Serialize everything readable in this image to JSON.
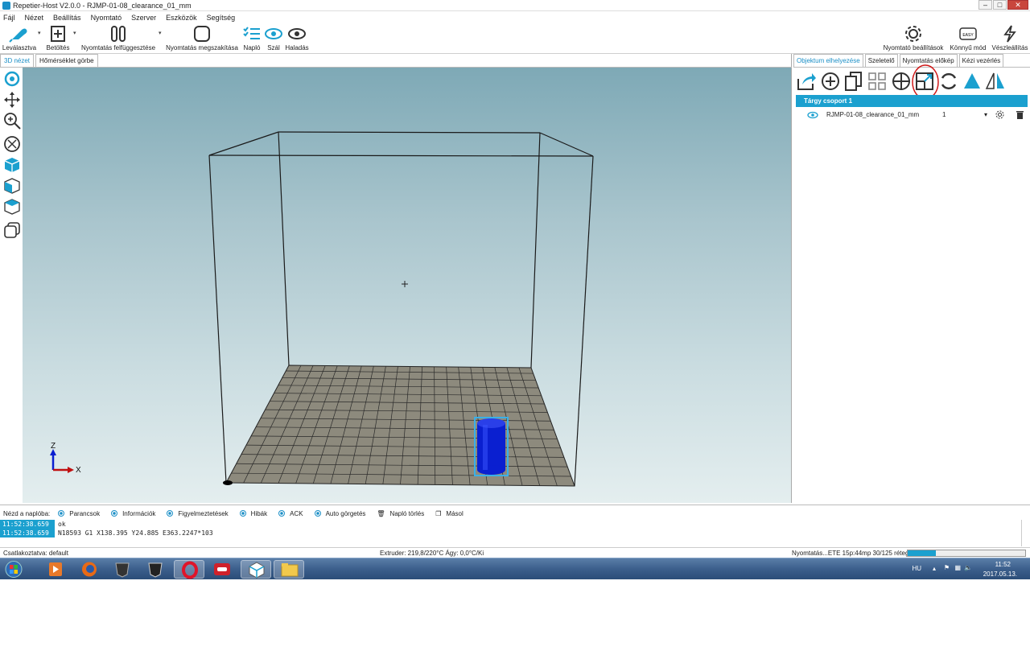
{
  "window": {
    "title": "Repetier-Host V2.0.0 - RJMP-01-08_clearance_01_mm",
    "min": "–",
    "max": "□",
    "close": "✕"
  },
  "menu": [
    "Fájl",
    "Nézet",
    "Beállítás",
    "Nyomtató",
    "Szerver",
    "Eszközök",
    "Segítség"
  ],
  "toolbar": {
    "disconnect": "Leválasztva",
    "load": "Betöltés",
    "pause": "Nyomtatás felfüggesztése",
    "stop": "Nyomtatás megszakítása",
    "log": "Napló",
    "filament": "Szál",
    "advanced": "Haladás",
    "printer_settings": "Nyomtató beállítások",
    "easy_mode": "Könnyű mód",
    "easy_badge": "EASY",
    "emergency": "Vészleállítás"
  },
  "view_tabs": [
    "3D nézet",
    "Hőmérséklet görbe"
  ],
  "right_tabs": [
    "Objektum elhelyezése",
    "Szeletelő",
    "Nyomtatás előkép",
    "Kézi vezérlés"
  ],
  "object_group": {
    "header": "Tárgy csoport 1",
    "objects": [
      {
        "name": "RJMP-01-08_clearance_01_mm",
        "count": "1"
      }
    ]
  },
  "axes": {
    "z": "Z",
    "x": "X"
  },
  "log": {
    "label": "Nézd a naplóba:",
    "filters": [
      "Parancsok",
      "Információk",
      "Figyelmeztetések",
      "Hibák",
      "ACK",
      "Auto görgetés"
    ],
    "clear": "Napló törlés",
    "copy": "Másol",
    "lines": [
      {
        "time": "11:52:38.659",
        "msg": "ok"
      },
      {
        "time": "11:52:38.659",
        "msg": "N18593 G1 X138.395 Y24.885 E363.2247*103"
      }
    ]
  },
  "status": {
    "connection": "Csatlakoztatva: default",
    "temps": "Extruder: 219,8/220°C Ágy: 0,0°C/Ki",
    "progress_text": "Nyomtatás...ETE 15p:44mp 30/125 réteg",
    "progress": 0.24
  },
  "taskbar": {
    "lang": "HU",
    "time": "11:52",
    "date": "2017.05.13."
  },
  "colors": {
    "accent": "#1ba0cf",
    "object": "#0a1fd0"
  }
}
